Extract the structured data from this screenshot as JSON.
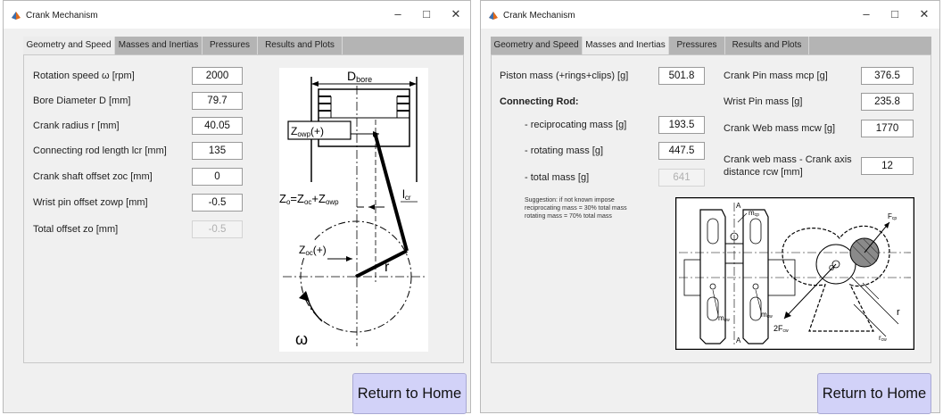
{
  "left_window": {
    "title": "Crank Mechanism",
    "controls": {
      "minimize": "–",
      "maximize": "□",
      "close": "✕"
    },
    "tabs": [
      {
        "label": "Geometry and Speed",
        "active": true
      },
      {
        "label": "Masses and Inertias",
        "active": false
      },
      {
        "label": "Pressures",
        "active": false
      },
      {
        "label": "Results and Plots",
        "active": false
      }
    ],
    "fields": [
      {
        "label": "Rotation speed ω [rpm]",
        "value": "2000"
      },
      {
        "label": "Bore Diameter D [mm]",
        "value": "79.7"
      },
      {
        "label": "Crank radius r [mm]",
        "value": "40.05"
      },
      {
        "label": "Connecting rod length lcr [mm]",
        "value": "135"
      },
      {
        "label": "Crank shaft offset zoc [mm]",
        "value": "0"
      },
      {
        "label": "Wrist pin offset zowp [mm]",
        "value": "-0.5"
      },
      {
        "label": "Total offset zo [mm]",
        "value": "-0.5",
        "disabled": true
      }
    ],
    "diagram": {
      "bore_label": "D",
      "bore_sub": "bore",
      "zowp_label": "Z",
      "zowp_sub": "owp",
      "zowp_suffix": "(+)",
      "zo_eq_z": "Z",
      "zo_eq_o": "o",
      "zo_eq_mid": "=Z",
      "zo_eq_oc": "oc",
      "zo_eq_plus": "+Z",
      "zo_eq_owp": "owp",
      "zoc_label": "Z",
      "zoc_sub": "oc",
      "zoc_suffix": "(+)",
      "lcr_label": "l",
      "lcr_sub": "cr",
      "r_label": "r",
      "omega_label": "ω"
    },
    "return_button": "Return to Home"
  },
  "right_window": {
    "title": "Crank Mechanism",
    "controls": {
      "minimize": "–",
      "maximize": "□",
      "close": "✕"
    },
    "tabs": [
      {
        "label": "Geometry and Speed",
        "active": false
      },
      {
        "label": "Masses and Inertias",
        "active": true
      },
      {
        "label": "Pressures",
        "active": false
      },
      {
        "label": "Results and Plots",
        "active": false
      }
    ],
    "piston_mass": {
      "label": "Piston mass (+rings+clips) [g]",
      "value": "501.8"
    },
    "connecting_rod_heading": "Connecting Rod:",
    "reciprocating_mass": {
      "label": "- reciprocating mass [g]",
      "value": "193.5"
    },
    "rotating_mass": {
      "label": "- rotating mass [g]",
      "value": "447.5"
    },
    "total_mass": {
      "label": "- total mass [g]",
      "value": "641"
    },
    "suggestion": "Suggestion: if not known impose\nreciprocating mass = 30% total mass\nrotating mass = 70% total mass",
    "crank_pin_mass": {
      "label": "Crank Pin mass mcp [g]",
      "value": "376.5"
    },
    "wrist_pin_mass": {
      "label": "Wrist Pin mass [g]",
      "value": "235.8"
    },
    "crank_web_mass": {
      "label": "Crank Web mass mcw [g]",
      "value": "1770"
    },
    "crank_web_distance": {
      "label_line1": "Crank web mass - Crank  axis",
      "label_line2": "distance rcw [mm]",
      "value": "12"
    },
    "diagram": {
      "a_top": "A",
      "a_bottom": "A",
      "mcp": "m",
      "mcp_sub": "cp",
      "fcp": "F",
      "fcp_sub": "cp",
      "o_label": "O",
      "mcw_left": "m",
      "mcw_left_sub": "cw",
      "mcw_right": "m",
      "mcw_right_sub": "cw",
      "two_fcw": "2F",
      "two_fcw_sub": "cw",
      "r_label": "r",
      "rcw": "r",
      "rcw_sub": "cw"
    },
    "return_button": "Return to Home"
  },
  "colors": {
    "tab_bar": "#b4b4b4",
    "active_tab": "#ececec",
    "button": "#d2d2f8",
    "matlab_icon": "#e06a1b"
  }
}
